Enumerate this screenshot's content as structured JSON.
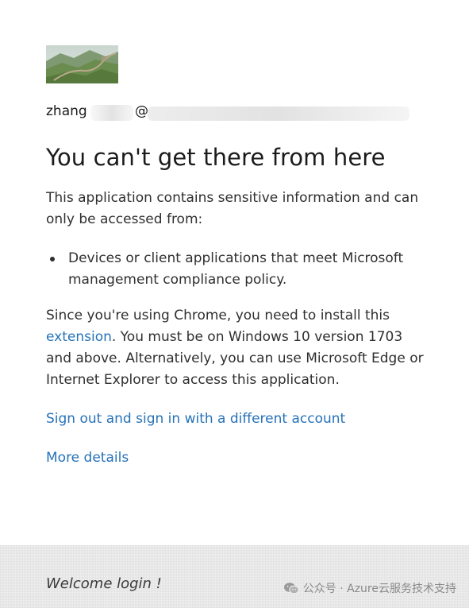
{
  "account": {
    "user_prefix": "zhang",
    "at_symbol": "@"
  },
  "page": {
    "title": "You can't get there from here",
    "intro": "This application contains sensitive information and can only be accessed from:",
    "bullets": [
      "Devices or client applications that meet Microsoft management compliance policy."
    ],
    "chrome_notice": {
      "before_link": "Since you're using Chrome, you need to install this ",
      "link_text": "extension",
      "after_link": ". You must be on Windows 10 version 1703 and above. Alternatively, you can use Microsoft Edge or Internet Explorer to access this application."
    },
    "sign_out_link": "Sign out and sign in with a different account",
    "more_details_link": "More details"
  },
  "footer": {
    "text": "Welcome login !",
    "watermark": "公众号 · Azure云服务技术支持",
    "watermark_icon": "wechat-icon"
  },
  "colors": {
    "link": "#2672b9",
    "text": "#2f2f2f",
    "footer_bg": "#f0f0f0"
  }
}
